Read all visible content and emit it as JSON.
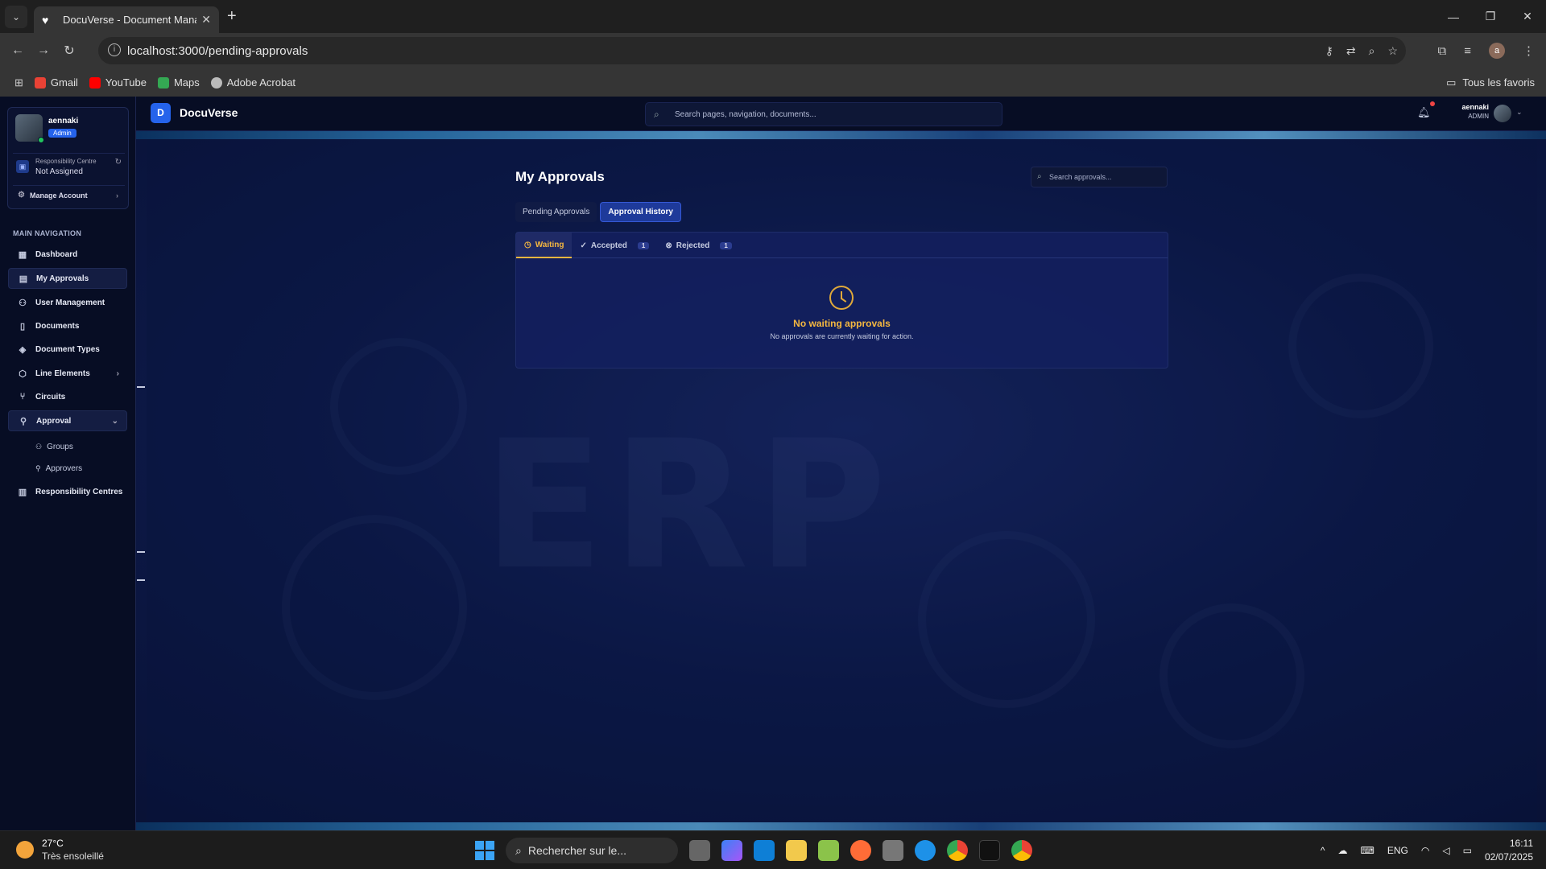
{
  "browser": {
    "tab_title": "DocuVerse - Document Manag",
    "url": "localhost:3000/pending-approvals",
    "bookmarks": [
      "Gmail",
      "YouTube",
      "Maps",
      "Adobe Acrobat"
    ],
    "all_bookmarks": "Tous les favoris",
    "profile_letter": "a"
  },
  "app": {
    "logo_letter": "D",
    "brand": "DocuVerse",
    "search_placeholder": "Search pages, navigation, documents...",
    "user_name": "aennaki",
    "user_role": "ADMIN"
  },
  "sidebar": {
    "user_name": "aennaki",
    "user_badge": "Admin",
    "rc_label": "Responsibility Centre",
    "rc_value": "Not Assigned",
    "manage_account": "Manage Account",
    "nav_heading": "MAIN NAVIGATION",
    "items": [
      {
        "label": "Dashboard"
      },
      {
        "label": "My Approvals"
      },
      {
        "label": "User Management"
      },
      {
        "label": "Documents"
      },
      {
        "label": "Document Types"
      },
      {
        "label": "Line Elements"
      },
      {
        "label": "Circuits"
      },
      {
        "label": "Approval"
      },
      {
        "label": "Responsibility Centres"
      }
    ],
    "subitems": [
      {
        "label": "Groups"
      },
      {
        "label": "Approvers"
      }
    ]
  },
  "main": {
    "title": "My Approvals",
    "search_placeholder": "Search approvals...",
    "segments": [
      "Pending Approvals",
      "Approval History"
    ],
    "subtabs": [
      {
        "label": "Waiting",
        "count": ""
      },
      {
        "label": "Accepted",
        "count": "1"
      },
      {
        "label": "Rejected",
        "count": "1"
      }
    ],
    "empty_title": "No waiting approvals",
    "empty_sub": "No approvals are currently waiting for action.",
    "background_text": "ERP"
  },
  "taskbar": {
    "temp": "27°C",
    "weather": "Très ensoleillé",
    "search": "Rechercher sur le...",
    "lang": "ENG",
    "time": "16:11",
    "date": "02/07/2025"
  }
}
